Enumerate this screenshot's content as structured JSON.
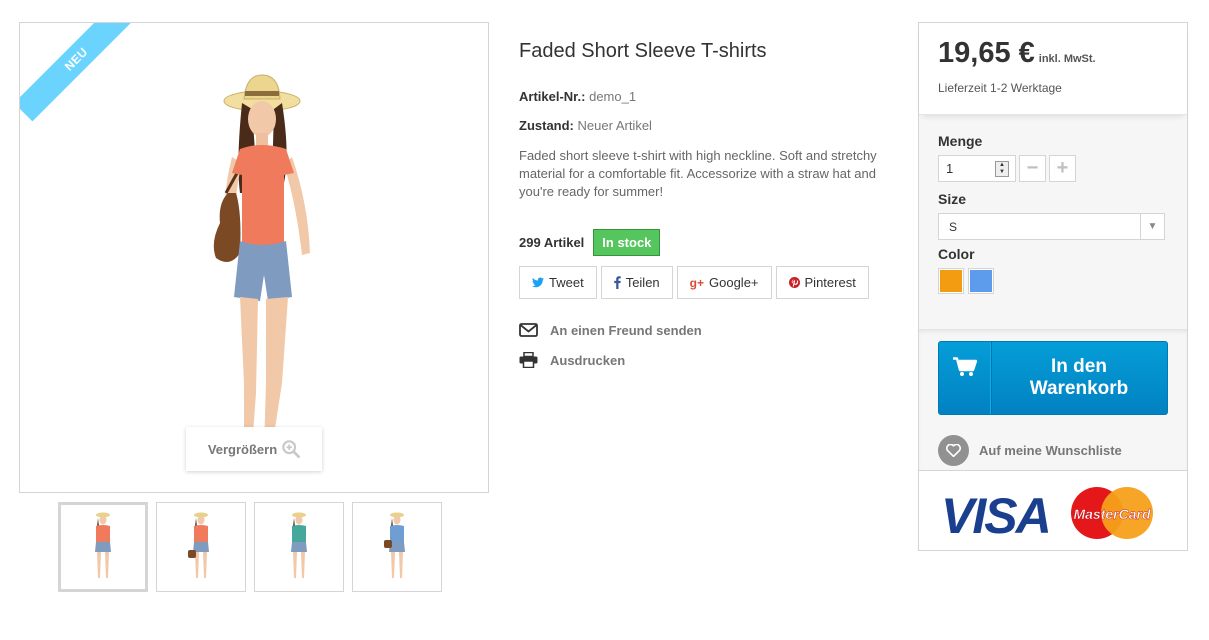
{
  "gallery": {
    "badge": "NEU",
    "zoom_label": "Vergrößern",
    "thumbnails": [
      {
        "alt": "thumbnail 1",
        "selected": true,
        "top_color": "#f07a5c"
      },
      {
        "alt": "thumbnail 2",
        "selected": false,
        "top_color": "#f07a5c"
      },
      {
        "alt": "thumbnail 3",
        "selected": false,
        "top_color": "#46a89a"
      },
      {
        "alt": "thumbnail 4",
        "selected": false,
        "top_color": "#6f9fd2"
      }
    ]
  },
  "product": {
    "title": "Faded Short Sleeve T-shirts",
    "reference_label": "Artikel-Nr.:",
    "reference_value": "demo_1",
    "condition_label": "Zustand:",
    "condition_value": "Neuer Artikel",
    "description": "Faded short sleeve t-shirt with high neckline. Soft and stretchy material for a comfortable fit. Accessorize with a straw hat and you're ready for summer!",
    "quantity_text": "299 Artikel",
    "availability": "In stock"
  },
  "share": {
    "tweet": "Tweet",
    "facebook": "Teilen",
    "google": "Google+",
    "pinterest": "Pinterest"
  },
  "actions": {
    "send_friend": "An einen Freund senden",
    "print": "Ausdrucken"
  },
  "buybox": {
    "price": "19,65 €",
    "tax_label": "inkl. MwSt.",
    "delivery": "Lieferzeit 1-2 Werktage",
    "quantity_label": "Menge",
    "quantity_value": "1",
    "minus": "−",
    "plus": "+",
    "size_label": "Size",
    "size_value": "S",
    "color_label": "Color",
    "colors": [
      "#f39c11",
      "#5d9cec"
    ],
    "cart_line1": "In den",
    "cart_line2": "Warenkorb",
    "wishlist": "Auf meine Wunschliste",
    "payment_logos": [
      "VISA",
      "MasterCard"
    ]
  }
}
